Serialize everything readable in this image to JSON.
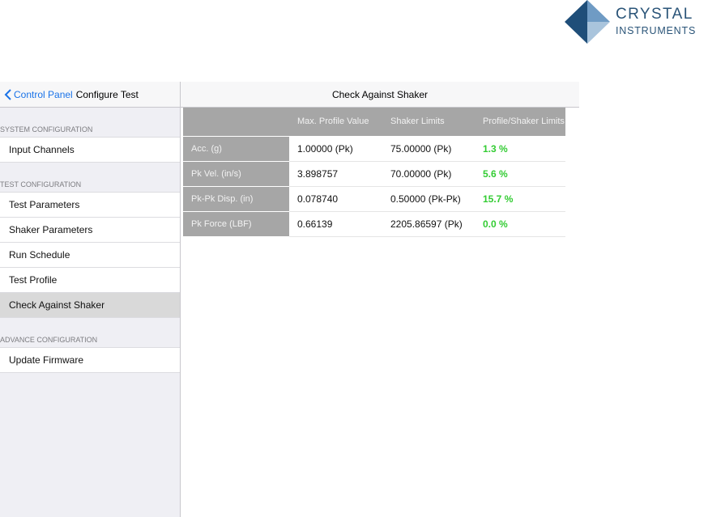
{
  "logo": {
    "title": "CRYSTAL",
    "subtitle": "INSTRUMENTS",
    "colors": {
      "dark": "#1f4e79",
      "light": "#6f9bc4"
    }
  },
  "sidebar": {
    "back_label": "Control Panel",
    "title": "Configure Test",
    "sections": [
      {
        "header": "SYSTEM CONFIGURATION",
        "items": [
          "Input Channels"
        ]
      },
      {
        "header": "TEST CONFIGURATION",
        "items": [
          "Test Parameters",
          "Shaker Parameters",
          "Run Schedule",
          "Test Profile",
          "Check Against Shaker"
        ]
      },
      {
        "header": "ADVANCE CONFIGURATION",
        "items": [
          "Update Firmware"
        ]
      }
    ],
    "selected_item": "Check Against Shaker"
  },
  "main": {
    "title": "Check Against Shaker",
    "columns": [
      "",
      "Max. Profile Value",
      "Shaker Limits",
      "Profile/Shaker Limits"
    ],
    "rows": [
      {
        "label": "Acc. (g)",
        "max_profile": "1.00000 (Pk)",
        "shaker_limit": "75.00000 (Pk)",
        "ratio": "1.3 %"
      },
      {
        "label": "Pk Vel. (in/s)",
        "max_profile": "3.898757",
        "shaker_limit": "70.00000 (Pk)",
        "ratio": "5.6 %"
      },
      {
        "label": "Pk-Pk Disp. (in)",
        "max_profile": "0.078740",
        "shaker_limit": "0.50000 (Pk-Pk)",
        "ratio": "15.7 %"
      },
      {
        "label": "Pk Force (LBF)",
        "max_profile": "0.66139",
        "shaker_limit": "2205.86597 (Pk)",
        "ratio": "0.0 %"
      }
    ],
    "colors": {
      "header_bg": "#a6a6a6",
      "ratio_text": "#33cc33",
      "link": "#1a73e8"
    }
  }
}
